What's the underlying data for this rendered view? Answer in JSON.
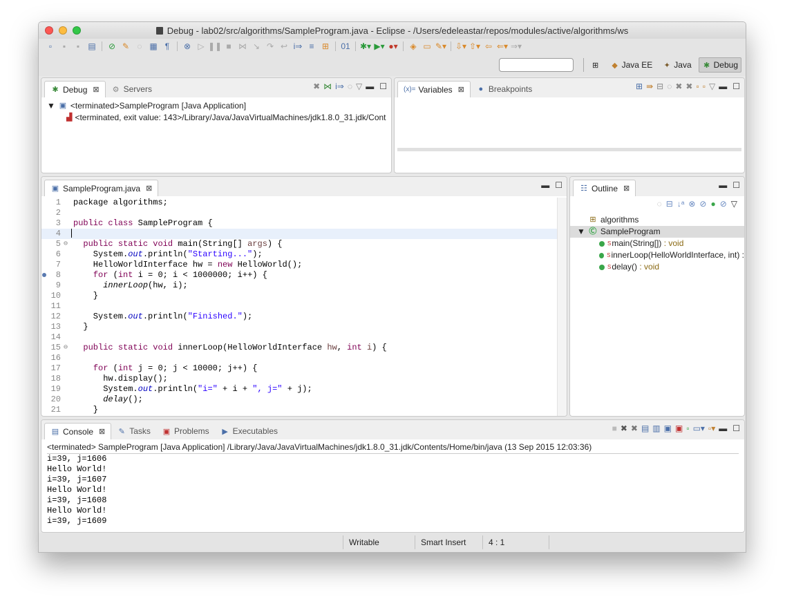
{
  "window": {
    "title": "Debug - lab02/src/algorithms/SampleProgram.java - Eclipse - /Users/edeleastar/repos/modules/active/algorithms/ws"
  },
  "perspectives": [
    {
      "label": "Java EE",
      "icon": "java-ee-icon"
    },
    {
      "label": "Java",
      "icon": "java-icon"
    },
    {
      "label": "Debug",
      "icon": "debug-bug-icon",
      "active": true
    }
  ],
  "debug_view": {
    "tabs": [
      {
        "label": "Debug",
        "icon": "bug-icon",
        "active": true
      },
      {
        "label": "Servers",
        "icon": "servers-icon"
      }
    ],
    "tree": {
      "launch": "<terminated>SampleProgram [Java Application]",
      "process": "<terminated, exit value: 143>/Library/Java/JavaVirtualMachines/jdk1.8.0_31.jdk/Cont"
    }
  },
  "variables_view": {
    "tabs": [
      {
        "label": "Variables",
        "prefix": "(x)=",
        "active": true
      },
      {
        "label": "Breakpoints",
        "icon": "breakpoints-icon"
      }
    ]
  },
  "editor": {
    "tab_label": "SampleProgram.java",
    "lines": [
      {
        "n": "1",
        "segs": [
          [
            "plain",
            "package algorithms;"
          ]
        ]
      },
      {
        "n": "2",
        "segs": []
      },
      {
        "n": "3",
        "segs": [
          [
            "kw",
            "public"
          ],
          [
            "plain",
            " "
          ],
          [
            "kw",
            "class"
          ],
          [
            "plain",
            " SampleProgram {"
          ]
        ]
      },
      {
        "n": "4",
        "segs": [],
        "current": true
      },
      {
        "n": "5",
        "fold": "⊖",
        "segs": [
          [
            "plain",
            "  "
          ],
          [
            "kw",
            "public"
          ],
          [
            "plain",
            " "
          ],
          [
            "kw",
            "static"
          ],
          [
            "plain",
            " "
          ],
          [
            "kw",
            "void"
          ],
          [
            "plain",
            " main(String[] "
          ],
          [
            "param",
            "args"
          ],
          [
            "plain",
            ") {"
          ]
        ]
      },
      {
        "n": "6",
        "segs": [
          [
            "plain",
            "    System."
          ],
          [
            "stat",
            "out"
          ],
          [
            "plain",
            ".println("
          ],
          [
            "str",
            "\"Starting...\""
          ],
          [
            "plain",
            ");"
          ]
        ]
      },
      {
        "n": "7",
        "segs": [
          [
            "plain",
            "    HelloWorldInterface hw = "
          ],
          [
            "kw",
            "new"
          ],
          [
            "plain",
            " HelloWorld();"
          ]
        ]
      },
      {
        "n": "8",
        "mark": true,
        "segs": [
          [
            "plain",
            "    "
          ],
          [
            "kw",
            "for"
          ],
          [
            "plain",
            " ("
          ],
          [
            "kw",
            "int"
          ],
          [
            "plain",
            " i = 0; i < 1000000; i++) {"
          ]
        ]
      },
      {
        "n": "9",
        "segs": [
          [
            "plain",
            "      "
          ],
          [
            "it",
            "innerLoop"
          ],
          [
            "plain",
            "(hw, i);"
          ]
        ]
      },
      {
        "n": "10",
        "segs": [
          [
            "plain",
            "    }"
          ]
        ]
      },
      {
        "n": "11",
        "segs": []
      },
      {
        "n": "12",
        "segs": [
          [
            "plain",
            "    System."
          ],
          [
            "stat",
            "out"
          ],
          [
            "plain",
            ".println("
          ],
          [
            "str",
            "\"Finished.\""
          ],
          [
            "plain",
            ");"
          ]
        ]
      },
      {
        "n": "13",
        "segs": [
          [
            "plain",
            "  }"
          ]
        ]
      },
      {
        "n": "14",
        "segs": []
      },
      {
        "n": "15",
        "fold": "⊖",
        "segs": [
          [
            "plain",
            "  "
          ],
          [
            "kw",
            "public"
          ],
          [
            "plain",
            " "
          ],
          [
            "kw",
            "static"
          ],
          [
            "plain",
            " "
          ],
          [
            "kw",
            "void"
          ],
          [
            "plain",
            " innerLoop(HelloWorldInterface "
          ],
          [
            "param",
            "hw"
          ],
          [
            "plain",
            ", "
          ],
          [
            "kw",
            "int"
          ],
          [
            "plain",
            " "
          ],
          [
            "param",
            "i"
          ],
          [
            "plain",
            ") {"
          ]
        ]
      },
      {
        "n": "16",
        "segs": []
      },
      {
        "n": "17",
        "segs": [
          [
            "plain",
            "    "
          ],
          [
            "kw",
            "for"
          ],
          [
            "plain",
            " ("
          ],
          [
            "kw",
            "int"
          ],
          [
            "plain",
            " j = 0; j < 10000; j++) {"
          ]
        ]
      },
      {
        "n": "18",
        "segs": [
          [
            "plain",
            "      hw.display();"
          ]
        ]
      },
      {
        "n": "19",
        "segs": [
          [
            "plain",
            "      System."
          ],
          [
            "stat",
            "out"
          ],
          [
            "plain",
            ".println("
          ],
          [
            "str",
            "\"i=\""
          ],
          [
            "plain",
            " + i + "
          ],
          [
            "str",
            "\", j=\""
          ],
          [
            "plain",
            " + j);"
          ]
        ]
      },
      {
        "n": "20",
        "segs": [
          [
            "plain",
            "      "
          ],
          [
            "it",
            "delay"
          ],
          [
            "plain",
            "();"
          ]
        ]
      },
      {
        "n": "21",
        "segs": [
          [
            "plain",
            "    }"
          ]
        ]
      }
    ]
  },
  "outline_view": {
    "tab_label": "Outline",
    "package": "algorithms",
    "class_name": "SampleProgram",
    "members": [
      {
        "sig": "main(String[])",
        "ret": " : void"
      },
      {
        "sig": "innerLoop(HelloWorldInterface, int) :",
        "ret": ""
      },
      {
        "sig": "delay()",
        "ret": " : void"
      }
    ]
  },
  "console_view": {
    "tabs": [
      {
        "label": "Console",
        "active": true
      },
      {
        "label": "Tasks"
      },
      {
        "label": "Problems"
      },
      {
        "label": "Executables"
      }
    ],
    "status": "<terminated> SampleProgram [Java Application] /Library/Java/JavaVirtualMachines/jdk1.8.0_31.jdk/Contents/Home/bin/java (13 Sep 2015 12:03:36)",
    "output": [
      "i=39, j=1606",
      "Hello World!",
      "i=39, j=1607",
      "Hello World!",
      "i=39, j=1608",
      "Hello World!",
      "i=39, j=1609"
    ]
  },
  "statusbar": {
    "writable": "Writable",
    "insert_mode": "Smart Insert",
    "position": "4 : 1"
  }
}
